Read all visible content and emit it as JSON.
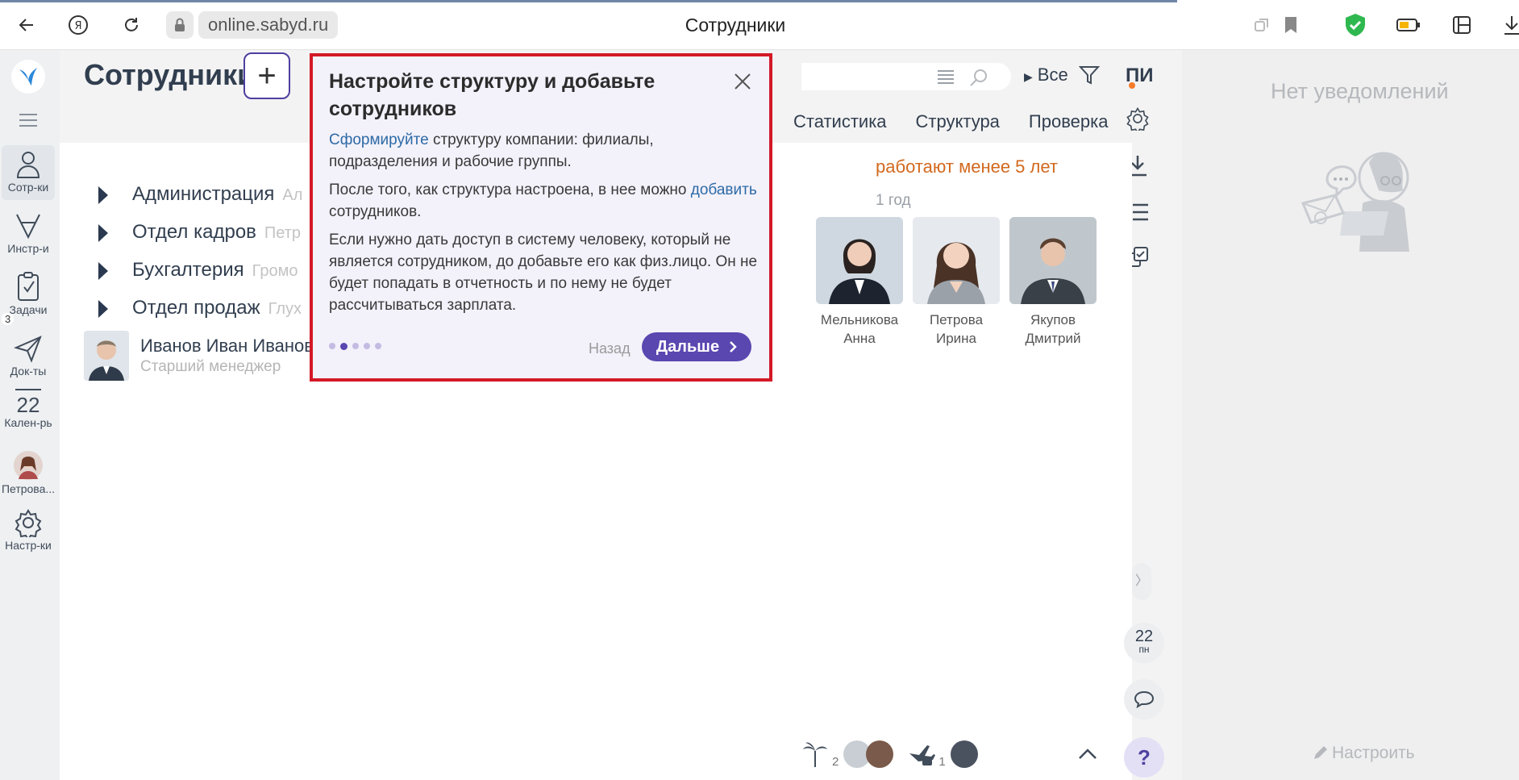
{
  "browser": {
    "url": "online.sabyd.ru",
    "tab_title": "Сотрудники"
  },
  "nav": {
    "items": [
      {
        "label": "Сотр-ки",
        "icon": "people-icon"
      },
      {
        "label": "Инстр-и",
        "icon": "instruments-icon"
      },
      {
        "label": "Задачи",
        "icon": "tasks-icon",
        "badge": "3"
      },
      {
        "label": "Док-ты",
        "icon": "send-icon"
      },
      {
        "label": "Кален-рь",
        "icon": "calendar-icon",
        "day": "22"
      },
      {
        "label": "Петрова...",
        "icon": "avatar"
      },
      {
        "label": "Настр-ки",
        "icon": "gear-icon"
      }
    ]
  },
  "page": {
    "title": "Сотрудники",
    "add_label": "+"
  },
  "toolbar": {
    "all_label": "Все",
    "user_initials": "ПИ"
  },
  "tabs": [
    "Статистика",
    "Структура",
    "Проверка"
  ],
  "tree": [
    {
      "label": "Администрация",
      "sub": "Ал"
    },
    {
      "label": "Отдел кадров",
      "sub": "Петр"
    },
    {
      "label": "Бухгалтерия",
      "sub": "Громо"
    },
    {
      "label": "Отдел продаж",
      "sub": "Глух"
    }
  ],
  "person": {
    "name": "Иванов Иван Иванов",
    "role": "Старший менеджер"
  },
  "anniversary": {
    "title": "работают менее 5 лет",
    "year": "1 год",
    "employees": [
      {
        "name_line1": "Мельникова",
        "name_line2": "Анна"
      },
      {
        "name_line1": "Петрова",
        "name_line2": "Ирина"
      },
      {
        "name_line1": "Якупов",
        "name_line2": "Дмитрий"
      }
    ]
  },
  "right_tools": {
    "date_day": "22",
    "date_weekday": "пн",
    "help": "?"
  },
  "bottom": {
    "vacation_count": "2",
    "trip_count": "1"
  },
  "notifications": {
    "title": "Нет уведомлений",
    "setup": "Настроить"
  },
  "popup": {
    "title": "Настройте структуру и добавьте сотрудников",
    "p1_link": "Сформируйте",
    "p1_rest": " структуру компании: филиалы, подразделения и рабочие группы.",
    "p2_start": "После того, как структура настроена, в нее можно ",
    "p2_link": "добавить",
    "p2_end": " сотрудников.",
    "p3": "Если нужно дать доступ в систему человеку, который не является сотрудником, до добавьте его как физ.лицо. Он не будет попадать в отчетность и по нему не будет рассчитываться зарплата.",
    "back": "Назад",
    "next": "Дальше",
    "step_current": 2,
    "step_total": 5
  }
}
